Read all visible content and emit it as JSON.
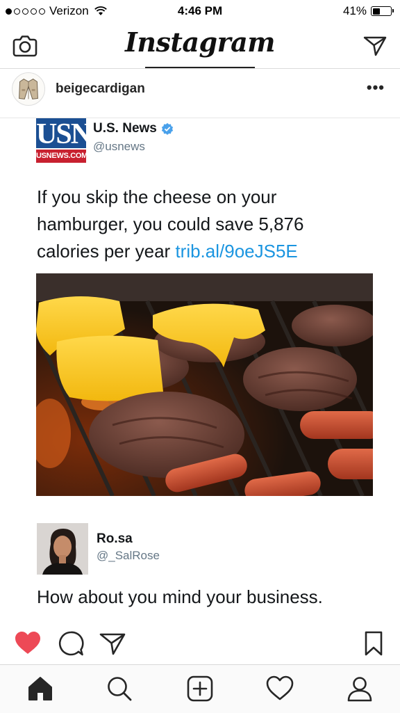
{
  "status_bar": {
    "carrier": "Verizon",
    "time": "4:46 PM",
    "battery_pct": "41%",
    "battery_level": 0.41,
    "signal_bars_filled": 1
  },
  "header": {
    "logo": "Instagram",
    "left_icon": "camera-icon",
    "right_icon": "direct-send-icon"
  },
  "post": {
    "username": "beigecardigan",
    "more": "•••",
    "liked": true,
    "colors": {
      "like": "#ed4956",
      "link": "#1b95e0"
    }
  },
  "tweet": {
    "logo_top": "USN",
    "logo_bottom": "USNEWS.COM",
    "name": "U.S. News",
    "handle": "@usnews",
    "text_lines": [
      "If you skip the cheese on your",
      "hamburger, you could save 5,876",
      "calories per year"
    ],
    "link": "trib.al/9oeJS5E"
  },
  "reply": {
    "name": "Ro.sa",
    "handle": "@_SalRose",
    "text": "How about you mind your business."
  },
  "actions": [
    "heart-filled-icon",
    "comment-icon",
    "share-icon",
    "bookmark-icon"
  ],
  "tabs": [
    "home-icon",
    "search-icon",
    "add-post-icon",
    "activity-heart-icon",
    "profile-icon"
  ]
}
